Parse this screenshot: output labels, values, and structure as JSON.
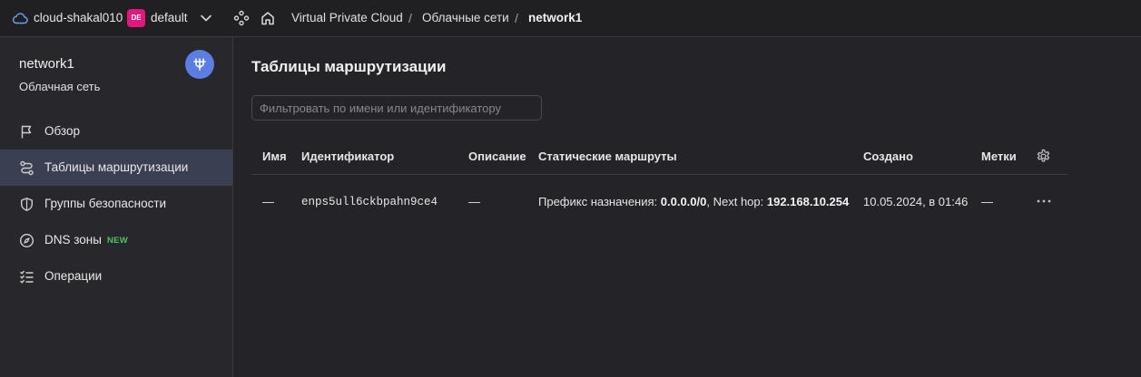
{
  "topbar": {
    "cloud_name": "cloud-shakal010",
    "folder_badge": "DE",
    "folder_name": "default",
    "breadcrumbs": [
      "Virtual Private Cloud",
      "Облачные сети",
      "network1"
    ],
    "separator": "/"
  },
  "sidebar": {
    "title": "network1",
    "subtitle": "Облачная сеть",
    "items": [
      {
        "label": "Обзор",
        "icon": "flag-icon"
      },
      {
        "label": "Таблицы маршрутизации",
        "icon": "route-icon",
        "active": true
      },
      {
        "label": "Группы безопасности",
        "icon": "shield-icon"
      },
      {
        "label": "DNS зоны",
        "icon": "compass-icon",
        "badge": "NEW"
      },
      {
        "label": "Операции",
        "icon": "list-icon"
      }
    ]
  },
  "main": {
    "title": "Таблицы маршрутизации",
    "filter_placeholder": "Фильтровать по имени или идентификатору",
    "columns": [
      "Имя",
      "Идентификатор",
      "Описание",
      "Статические маршруты",
      "Создано",
      "Метки"
    ],
    "rows": [
      {
        "name": "—",
        "id": "enps5ull6ckbpahn9ce4",
        "description": "—",
        "route_prefix_label": "Префикс назначения: ",
        "route_prefix": "0.0.0.0/0",
        "route_nexthop_label": ", Next hop: ",
        "route_nexthop": "192.168.10.254",
        "created": "10.05.2024, в 01:46",
        "labels": "—"
      }
    ]
  },
  "colors": {
    "background": "#242428",
    "sidebar_active": "#3a3f52",
    "avatar": "#5b7ee5",
    "folder_badge": "#e0187f",
    "new_badge": "#4fbf6a"
  }
}
